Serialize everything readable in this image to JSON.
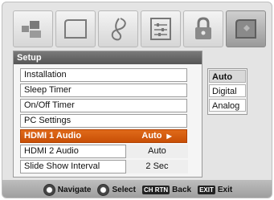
{
  "top_icons": [
    {
      "name": "picture-icon"
    },
    {
      "name": "display-icon"
    },
    {
      "name": "audio-icon"
    },
    {
      "name": "preferences-icon"
    },
    {
      "name": "lock-icon"
    },
    {
      "name": "setup-icon",
      "active": true
    }
  ],
  "panel": {
    "title": "Setup"
  },
  "menu": {
    "items": [
      {
        "label": "Installation"
      },
      {
        "label": "Sleep Timer"
      },
      {
        "label": "On/Off Timer"
      },
      {
        "label": "PC Settings"
      },
      {
        "label": "HDMI 1 Audio",
        "value": "Auto",
        "selected": true
      },
      {
        "label": "HDMI 2 Audio",
        "value": "Auto"
      },
      {
        "label": "Slide Show Interval",
        "value": "2 Sec"
      }
    ]
  },
  "submenu": {
    "options": [
      "Auto",
      "Digital",
      "Analog"
    ],
    "selected": "Auto"
  },
  "footer": {
    "navigate": "Navigate",
    "select": "Select",
    "back_key": "CH RTN",
    "back": "Back",
    "exit_key": "EXIT",
    "exit": "Exit"
  },
  "colors": {
    "highlight": "#d85c10",
    "title_bar": "#666666",
    "background": "#e4e4e4"
  }
}
